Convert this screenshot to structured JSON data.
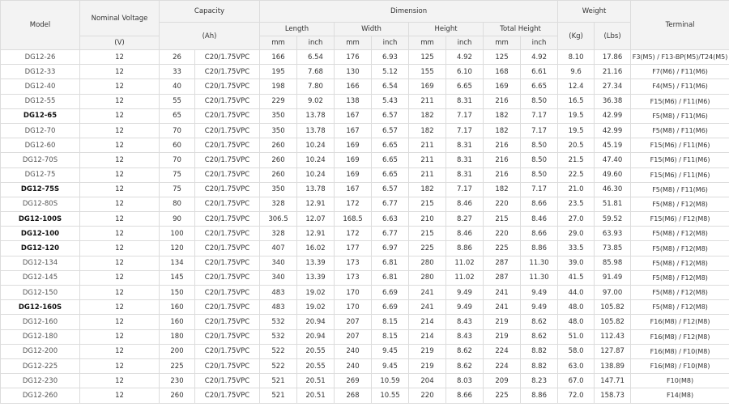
{
  "headers": {
    "model": "Model",
    "nominal_voltage": "Nominal Voltage",
    "voltage_unit": "(V)",
    "capacity": "Capacity",
    "capacity_unit": "(Ah)",
    "dimension": "Dimension",
    "length": "Length",
    "width": "Width",
    "height": "Height",
    "total_height": "Total Height",
    "mm": "mm",
    "inch": "inch",
    "weight": "Weight",
    "kg": "(Kg)",
    "lbs": "(Lbs)",
    "terminal": "Terminal"
  },
  "rows": [
    {
      "model": "DG12-26",
      "v": "12",
      "ah": "26",
      "rate": "C20/1.75VPC",
      "l_mm": "166",
      "l_in": "6.54",
      "w_mm": "176",
      "w_in": "6.93",
      "h_mm": "125",
      "h_in": "4.92",
      "th_mm": "125",
      "th_in": "4.92",
      "kg": "8.10",
      "lbs": "17.86",
      "terminal": "F3(M5) / F13-BP(M5)/T24(M5)"
    },
    {
      "model": "DG12-33",
      "v": "12",
      "ah": "33",
      "rate": "C20/1.75VPC",
      "l_mm": "195",
      "l_in": "7.68",
      "w_mm": "130",
      "w_in": "5.12",
      "h_mm": "155",
      "h_in": "6.10",
      "th_mm": "168",
      "th_in": "6.61",
      "kg": "9.6",
      "lbs": "21.16",
      "terminal": "F7(M6) / F11(M6)"
    },
    {
      "model": "DG12-40",
      "v": "12",
      "ah": "40",
      "rate": "C20/1.75VPC",
      "l_mm": "198",
      "l_in": "7.80",
      "w_mm": "166",
      "w_in": "6.54",
      "h_mm": "169",
      "h_in": "6.65",
      "th_mm": "169",
      "th_in": "6.65",
      "kg": "12.4",
      "lbs": "27.34",
      "terminal": "F4(M5) / F11(M6)"
    },
    {
      "model": "DG12-55",
      "v": "12",
      "ah": "55",
      "rate": "C20/1.75VPC",
      "l_mm": "229",
      "l_in": "9.02",
      "w_mm": "138",
      "w_in": "5.43",
      "h_mm": "211",
      "h_in": "8.31",
      "th_mm": "216",
      "th_in": "8.50",
      "kg": "16.5",
      "lbs": "36.38",
      "terminal": "F15(M6) / F11(M6)"
    },
    {
      "model": "DG12-65",
      "v": "12",
      "ah": "65",
      "rate": "C20/1.75VPC",
      "l_mm": "350",
      "l_in": "13.78",
      "w_mm": "167",
      "w_in": "6.57",
      "h_mm": "182",
      "h_in": "7.17",
      "th_mm": "182",
      "th_in": "7.17",
      "kg": "19.5",
      "lbs": "42.99",
      "terminal": "F5(M8) / F11(M6)",
      "bold": true
    },
    {
      "model": "DG12-70",
      "v": "12",
      "ah": "70",
      "rate": "C20/1.75VPC",
      "l_mm": "350",
      "l_in": "13.78",
      "w_mm": "167",
      "w_in": "6.57",
      "h_mm": "182",
      "h_in": "7.17",
      "th_mm": "182",
      "th_in": "7.17",
      "kg": "19.5",
      "lbs": "42.99",
      "terminal": "F5(M8) / F11(M6)"
    },
    {
      "model": "DG12-60",
      "v": "12",
      "ah": "60",
      "rate": "C20/1.75VPC",
      "l_mm": "260",
      "l_in": "10.24",
      "w_mm": "169",
      "w_in": "6.65",
      "h_mm": "211",
      "h_in": "8.31",
      "th_mm": "216",
      "th_in": "8.50",
      "kg": "20.5",
      "lbs": "45.19",
      "terminal": "F15(M6) / F11(M6)"
    },
    {
      "model": "DG12-70S",
      "v": "12",
      "ah": "70",
      "rate": "C20/1.75VPC",
      "l_mm": "260",
      "l_in": "10.24",
      "w_mm": "169",
      "w_in": "6.65",
      "h_mm": "211",
      "h_in": "8.31",
      "th_mm": "216",
      "th_in": "8.50",
      "kg": "21.5",
      "lbs": "47.40",
      "terminal": "F15(M6) / F11(M6)"
    },
    {
      "model": "DG12-75",
      "v": "12",
      "ah": "75",
      "rate": "C20/1.75VPC",
      "l_mm": "260",
      "l_in": "10.24",
      "w_mm": "169",
      "w_in": "6.65",
      "h_mm": "211",
      "h_in": "8.31",
      "th_mm": "216",
      "th_in": "8.50",
      "kg": "22.5",
      "lbs": "49.60",
      "terminal": "F15(M6) / F11(M6)"
    },
    {
      "model": "DG12-75S",
      "v": "12",
      "ah": "75",
      "rate": "C20/1.75VPC",
      "l_mm": "350",
      "l_in": "13.78",
      "w_mm": "167",
      "w_in": "6.57",
      "h_mm": "182",
      "h_in": "7.17",
      "th_mm": "182",
      "th_in": "7.17",
      "kg": "21.0",
      "lbs": "46.30",
      "terminal": "F5(M8) / F11(M6)",
      "bold": true
    },
    {
      "model": "DG12-80S",
      "v": "12",
      "ah": "80",
      "rate": "C20/1.75VPC",
      "l_mm": "328",
      "l_in": "12.91",
      "w_mm": "172",
      "w_in": "6.77",
      "h_mm": "215",
      "h_in": "8.46",
      "th_mm": "220",
      "th_in": "8.66",
      "kg": "23.5",
      "lbs": "51.81",
      "terminal": "F5(M8) / F12(M8)"
    },
    {
      "model": "DG12-100S",
      "v": "12",
      "ah": "90",
      "rate": "C20/1.75VPC",
      "l_mm": "306.5",
      "l_in": "12.07",
      "w_mm": "168.5",
      "w_in": "6.63",
      "h_mm": "210",
      "h_in": "8.27",
      "th_mm": "215",
      "th_in": "8.46",
      "kg": "27.0",
      "lbs": "59.52",
      "terminal": "F15(M6) / F12(M8)",
      "bold": true
    },
    {
      "model": "DG12-100",
      "v": "12",
      "ah": "100",
      "rate": "C20/1.75VPC",
      "l_mm": "328",
      "l_in": "12.91",
      "w_mm": "172",
      "w_in": "6.77",
      "h_mm": "215",
      "h_in": "8.46",
      "th_mm": "220",
      "th_in": "8.66",
      "kg": "29.0",
      "lbs": "63.93",
      "terminal": "F5(M8) / F12(M8)",
      "bold": true
    },
    {
      "model": "DG12-120",
      "v": "12",
      "ah": "120",
      "rate": "C20/1.75VPC",
      "l_mm": "407",
      "l_in": "16.02",
      "w_mm": "177",
      "w_in": "6.97",
      "h_mm": "225",
      "h_in": "8.86",
      "th_mm": "225",
      "th_in": "8.86",
      "kg": "33.5",
      "lbs": "73.85",
      "terminal": "F5(M8) / F12(M8)",
      "bold": true
    },
    {
      "model": "DG12-134",
      "v": "12",
      "ah": "134",
      "rate": "C20/1.75VPC",
      "l_mm": "340",
      "l_in": "13.39",
      "w_mm": "173",
      "w_in": "6.81",
      "h_mm": "280",
      "h_in": "11.02",
      "th_mm": "287",
      "th_in": "11.30",
      "kg": "39.0",
      "lbs": "85.98",
      "terminal": "F5(M8) / F12(M8)"
    },
    {
      "model": "DG12-145",
      "v": "12",
      "ah": "145",
      "rate": "C20/1.75VPC",
      "l_mm": "340",
      "l_in": "13.39",
      "w_mm": "173",
      "w_in": "6.81",
      "h_mm": "280",
      "h_in": "11.02",
      "th_mm": "287",
      "th_in": "11.30",
      "kg": "41.5",
      "lbs": "91.49",
      "terminal": "F5(M8) / F12(M8)"
    },
    {
      "model": "DG12-150",
      "v": "12",
      "ah": "150",
      "rate": "C20/1.75VPC",
      "l_mm": "483",
      "l_in": "19.02",
      "w_mm": "170",
      "w_in": "6.69",
      "h_mm": "241",
      "h_in": "9.49",
      "th_mm": "241",
      "th_in": "9.49",
      "kg": "44.0",
      "lbs": "97.00",
      "terminal": "F5(M8) / F12(M8)"
    },
    {
      "model": "DG12-160S",
      "v": "12",
      "ah": "160",
      "rate": "C20/1.75VPC",
      "l_mm": "483",
      "l_in": "19.02",
      "w_mm": "170",
      "w_in": "6.69",
      "h_mm": "241",
      "h_in": "9.49",
      "th_mm": "241",
      "th_in": "9.49",
      "kg": "48.0",
      "lbs": "105.82",
      "terminal": "F5(M8) / F12(M8)",
      "bold": true
    },
    {
      "model": "DG12-160",
      "v": "12",
      "ah": "160",
      "rate": "C20/1.75VPC",
      "l_mm": "532",
      "l_in": "20.94",
      "w_mm": "207",
      "w_in": "8.15",
      "h_mm": "214",
      "h_in": "8.43",
      "th_mm": "219",
      "th_in": "8.62",
      "kg": "48.0",
      "lbs": "105.82",
      "terminal": "F16(M8) / F12(M8)"
    },
    {
      "model": "DG12-180",
      "v": "12",
      "ah": "180",
      "rate": "C20/1.75VPC",
      "l_mm": "532",
      "l_in": "20.94",
      "w_mm": "207",
      "w_in": "8.15",
      "h_mm": "214",
      "h_in": "8.43",
      "th_mm": "219",
      "th_in": "8.62",
      "kg": "51.0",
      "lbs": "112.43",
      "terminal": "F16(M8) / F12(M8)"
    },
    {
      "model": "DG12-200",
      "v": "12",
      "ah": "200",
      "rate": "C20/1.75VPC",
      "l_mm": "522",
      "l_in": "20.55",
      "w_mm": "240",
      "w_in": "9.45",
      "h_mm": "219",
      "h_in": "8.62",
      "th_mm": "224",
      "th_in": "8.82",
      "kg": "58.0",
      "lbs": "127.87",
      "terminal": "F16(M8) / F10(M8)"
    },
    {
      "model": "DG12-225",
      "v": "12",
      "ah": "225",
      "rate": "C20/1.75VPC",
      "l_mm": "522",
      "l_in": "20.55",
      "w_mm": "240",
      "w_in": "9.45",
      "h_mm": "219",
      "h_in": "8.62",
      "th_mm": "224",
      "th_in": "8.82",
      "kg": "63.0",
      "lbs": "138.89",
      "terminal": "F16(M8) / F10(M8)"
    },
    {
      "model": "DG12-230",
      "v": "12",
      "ah": "230",
      "rate": "C20/1.75VPC",
      "l_mm": "521",
      "l_in": "20.51",
      "w_mm": "269",
      "w_in": "10.59",
      "h_mm": "204",
      "h_in": "8.03",
      "th_mm": "209",
      "th_in": "8.23",
      "kg": "67.0",
      "lbs": "147.71",
      "terminal": "F10(M8)"
    },
    {
      "model": "DG12-260",
      "v": "12",
      "ah": "260",
      "rate": "C20/1.75VPC",
      "l_mm": "521",
      "l_in": "20.51",
      "w_mm": "268",
      "w_in": "10.55",
      "h_mm": "220",
      "h_in": "8.66",
      "th_mm": "225",
      "th_in": "8.86",
      "kg": "72.0",
      "lbs": "158.73",
      "terminal": "F14(M8)"
    }
  ]
}
